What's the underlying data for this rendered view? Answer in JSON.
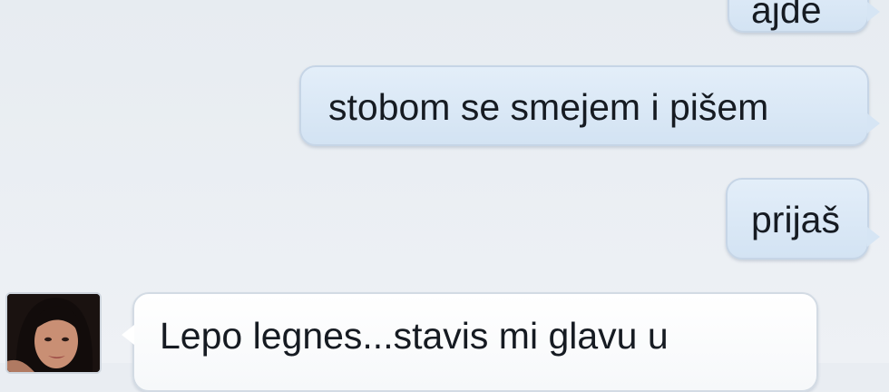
{
  "conversation": {
    "messages": [
      {
        "direction": "outgoing",
        "text": "ajde"
      },
      {
        "direction": "outgoing",
        "text": "stobom se smejem i pišem"
      },
      {
        "direction": "outgoing",
        "text": "prijaš"
      },
      {
        "direction": "incoming",
        "text": "Lepo legnes...stavis mi glavu u"
      }
    ],
    "contact_avatar_icon": "contact-photo"
  },
  "colors": {
    "background": "#e9edf2",
    "outgoing_bubble": "#d6e5f4",
    "incoming_bubble": "#ffffff",
    "text": "#161b22"
  }
}
